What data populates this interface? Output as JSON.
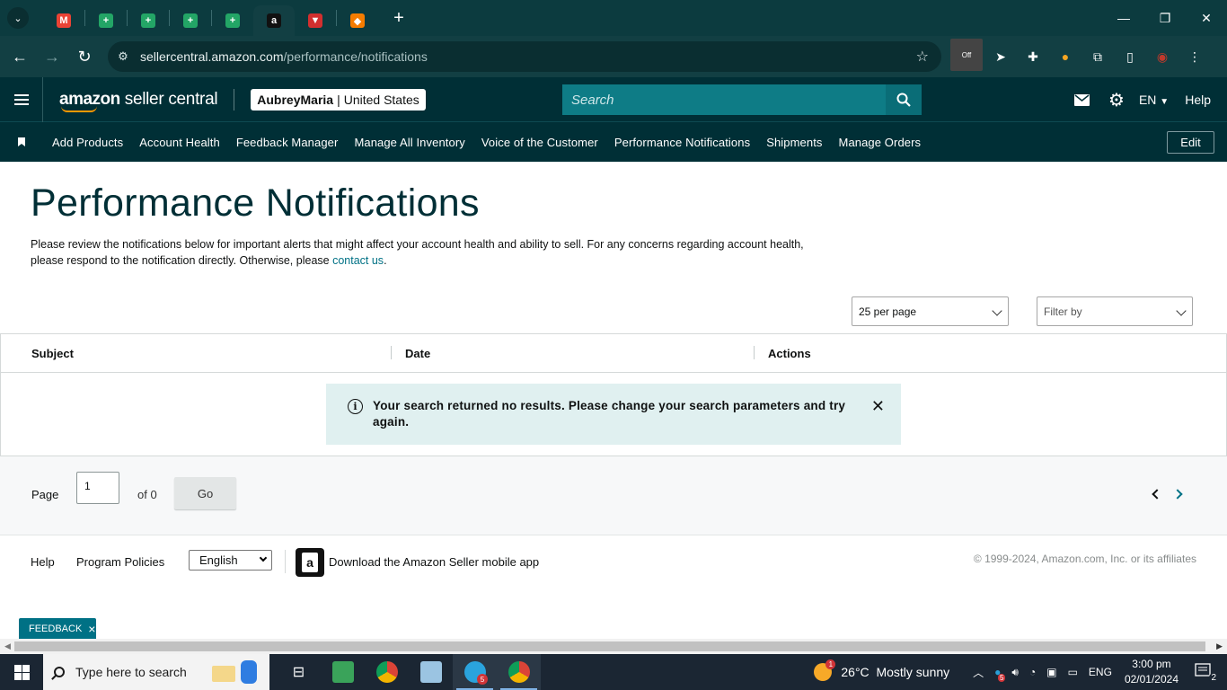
{
  "browser": {
    "url_host": "sellercentral.amazon.com",
    "url_path": "/performance/notifications",
    "tabs": [
      {
        "icon": "gmail-icon",
        "color": "#ea4335",
        "glyph": "M"
      },
      {
        "icon": "sheets-icon",
        "color": "#23a566",
        "glyph": "+"
      },
      {
        "icon": "sheets-icon",
        "color": "#23a566",
        "glyph": "+"
      },
      {
        "icon": "sheets-icon",
        "color": "#23a566",
        "glyph": "+"
      },
      {
        "icon": "sheets-icon",
        "color": "#23a566",
        "glyph": "+"
      },
      {
        "icon": "amazon-icon",
        "color": "#111111",
        "glyph": "a",
        "active": true
      },
      {
        "icon": "red-app-icon",
        "color": "#d32f2f",
        "glyph": "▼"
      },
      {
        "icon": "orange-app-icon",
        "color": "#f57c00",
        "glyph": "◆"
      }
    ],
    "ext_off_label": "Off"
  },
  "header": {
    "logo_bold": "amazon",
    "logo_light": "seller central",
    "account_name": "AubreyMaria",
    "account_sep": "|",
    "account_region": "United States",
    "search_placeholder": "Search",
    "language": "EN",
    "help": "Help"
  },
  "nav": {
    "links": [
      "Add Products",
      "Account Health",
      "Feedback Manager",
      "Manage All Inventory",
      "Voice of the Customer",
      "Performance Notifications",
      "Shipments",
      "Manage Orders"
    ],
    "edit": "Edit"
  },
  "main": {
    "title": "Performance Notifications",
    "intro": "Please review the notifications below for important alerts that might affect your account health and ability to sell. For any concerns regarding account health, please respond to the notification directly. Otherwise, please",
    "contact_link": "contact us",
    "intro_end": ".",
    "per_page": "25 per page",
    "filter_placeholder": "Filter by",
    "columns": {
      "subject": "Subject",
      "date": "Date",
      "actions": "Actions"
    },
    "alert_message": "Your search returned no results. Please change your search parameters and try again.",
    "alert_info_glyph": "i",
    "alert_close_glyph": "✕"
  },
  "pager": {
    "page_label": "Page",
    "page_value": "1",
    "of_label": "of 0",
    "go": "Go"
  },
  "footer": {
    "help": "Help",
    "program_policies": "Program Policies",
    "language": "English",
    "app_icon_glyph": "a",
    "download_app": "Download the Amazon Seller mobile app",
    "copyright": "© 1999-2024, Amazon.com, Inc. or its affiliates"
  },
  "feedback": {
    "label": "FEEDBACK",
    "close": "×"
  },
  "taskbar": {
    "search_placeholder": "Type here to search",
    "weather_temp": "26°C",
    "weather_text": "Mostly sunny",
    "weather_badge": "1",
    "lang": "ENG",
    "time": "3:00 pm",
    "date": "02/01/2024",
    "notification_count": "2",
    "telegram_badge": "5",
    "tray_badge": "5"
  },
  "colors": {
    "header_bg": "#002f36",
    "browser_bg": "#0c3b3f",
    "search_bg": "#0e7c86",
    "link": "#007185",
    "alert_bg": "#e0f0f0"
  }
}
